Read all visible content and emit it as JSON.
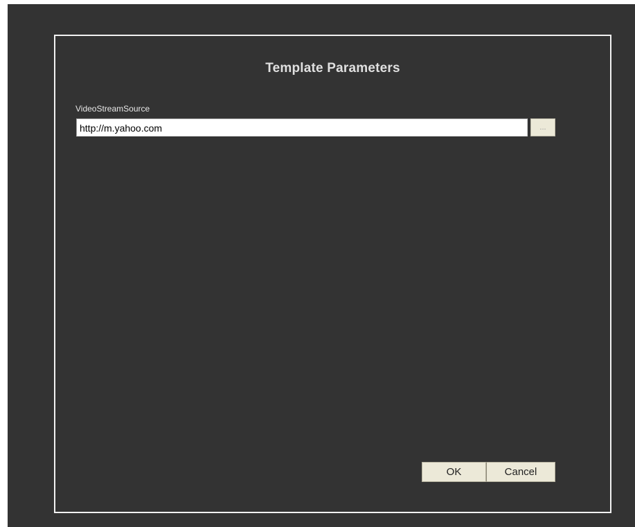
{
  "dialog": {
    "title": "Template Parameters"
  },
  "parameter": {
    "label": "VideoStreamSource",
    "value": "http://m.yahoo.com",
    "browse_label": "..."
  },
  "buttons": {
    "ok_label": "OK",
    "cancel_label": "Cancel"
  },
  "colors": {
    "background": "#333333",
    "frame_border": "#f2f2f2",
    "button_face": "#ece9d8"
  }
}
